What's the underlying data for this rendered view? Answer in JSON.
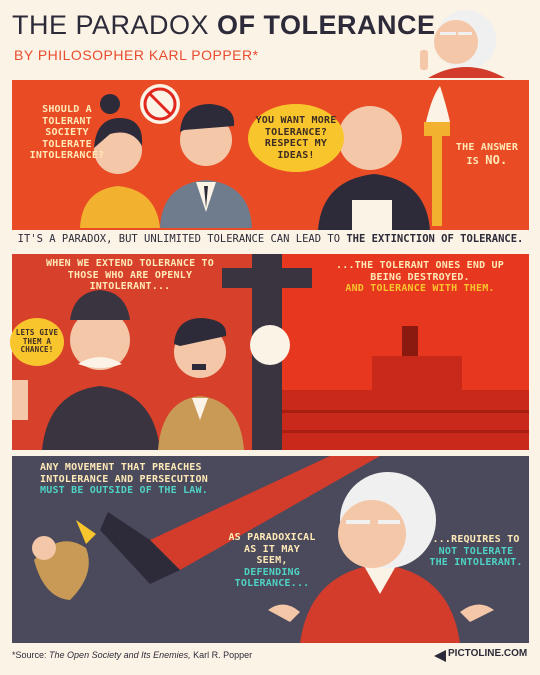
{
  "header": {
    "title_part1": "THE PARADOX",
    "title_part2": "OF TOLERANCE",
    "subtitle": "BY PHILOSOPHER KARL POPPER*"
  },
  "panel1": {
    "question": "SHOULD A TOLERANT SOCIETY TOLERATE INTOLERANCE?",
    "speech_bubble": "YOU WANT MORE TOLERANCE? RESPECT MY IDEAS!",
    "answer_prefix": "THE ANSWER IS",
    "answer_word": "NO."
  },
  "tagline": {
    "normal": "IT'S A PARADOX, BUT UNLIMITED TOLERANCE CAN LEAD TO",
    "bold": "THE EXTINCTION OF TOLERANCE."
  },
  "panel2": {
    "left_text": "WHEN WE EXTEND TOLERANCE TO THOSE WHO ARE OPENLY INTOLERANT...",
    "speech_bubble": "LETS GIVE THEM A CHANCE!",
    "right_text": "...THE TOLERANT ONES END UP BEING DESTROYED.",
    "right_highlight": "AND TOLERANCE WITH THEM."
  },
  "panel3": {
    "top_text": "ANY MOVEMENT THAT PREACHES INTOLERANCE AND PERSECUTION",
    "top_highlight": "MUST BE OUTSIDE OF THE LAW.",
    "mid_text": "AS PARADOXICAL AS IT MAY SEEM,",
    "mid_highlight": "DEFENDING TOLERANCE...",
    "right_text": "...REQUIRES TO",
    "right_highlight": "NOT TOLERATE THE INTOLERANT."
  },
  "footer": {
    "source_label": "*Source:",
    "source_title": "The Open Society and Its Enemies,",
    "source_author": "Karl R. Popper",
    "logo": "PICTOLINE.COM"
  },
  "colors": {
    "accent_red": "#e94b25",
    "accent_yellow": "#f9c52c",
    "accent_teal": "#4fd3c4",
    "dark": "#2d2b39"
  }
}
